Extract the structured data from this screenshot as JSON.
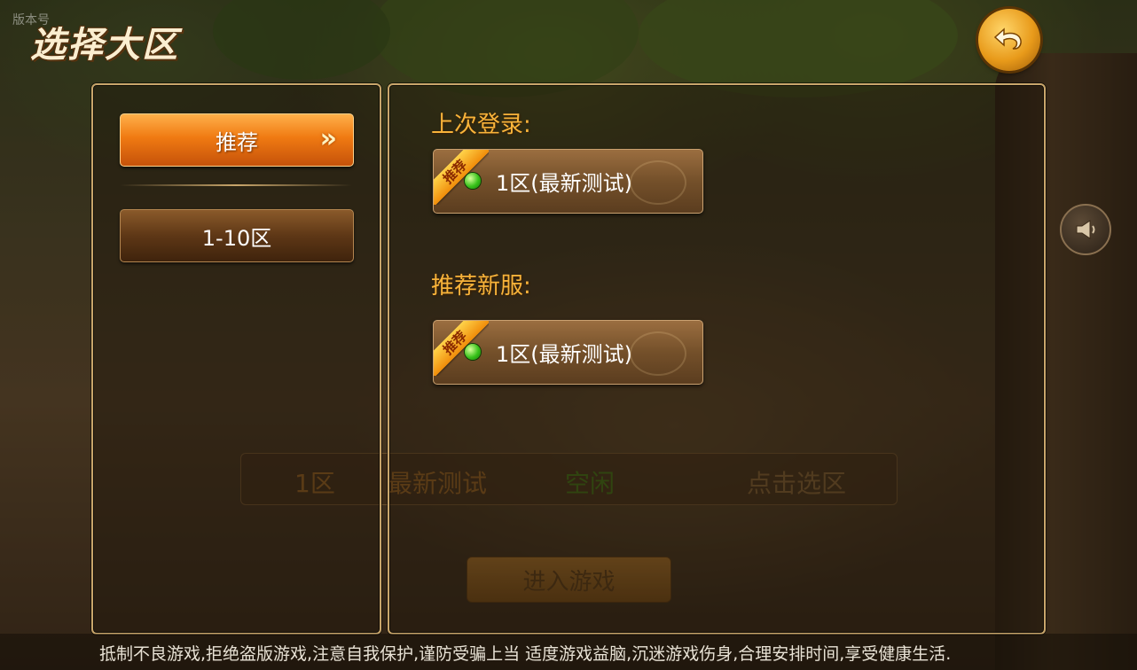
{
  "header": {
    "watermark": "版本号",
    "title": "选择大区"
  },
  "sidebar": {
    "tabs": [
      {
        "label": "推荐",
        "active": true
      },
      {
        "label": "1-10区",
        "active": false
      }
    ]
  },
  "main": {
    "last_login": {
      "label": "上次登录:",
      "server": {
        "badge": "推荐",
        "name": "1区(最新测试)",
        "status_color": "#37c21a"
      }
    },
    "recommended": {
      "label": "推荐新服:",
      "server": {
        "badge": "推荐",
        "name": "1区(最新测试)",
        "status_color": "#37c21a"
      }
    }
  },
  "background_row": {
    "zone": "1区",
    "name": "最新测试",
    "status": "空闲",
    "action": "点击选区"
  },
  "enter_button": {
    "label": "进入游戏"
  },
  "footer": {
    "notice": "抵制不良游戏,拒绝盗版游戏,注意自我保护,谨防受骗上当 适度游戏益脑,沉迷游戏伤身,合理安排时间,享受健康生活."
  },
  "icons": {
    "back": "back-arrow-icon",
    "announcement": "horn-icon",
    "tab_arrow": "double-chevron-right-icon",
    "server_status": "online-dot-icon"
  },
  "colors": {
    "accent_orange": "#f07a12",
    "label_gold": "#f8b33a",
    "panel_border": "#c9a66b"
  }
}
